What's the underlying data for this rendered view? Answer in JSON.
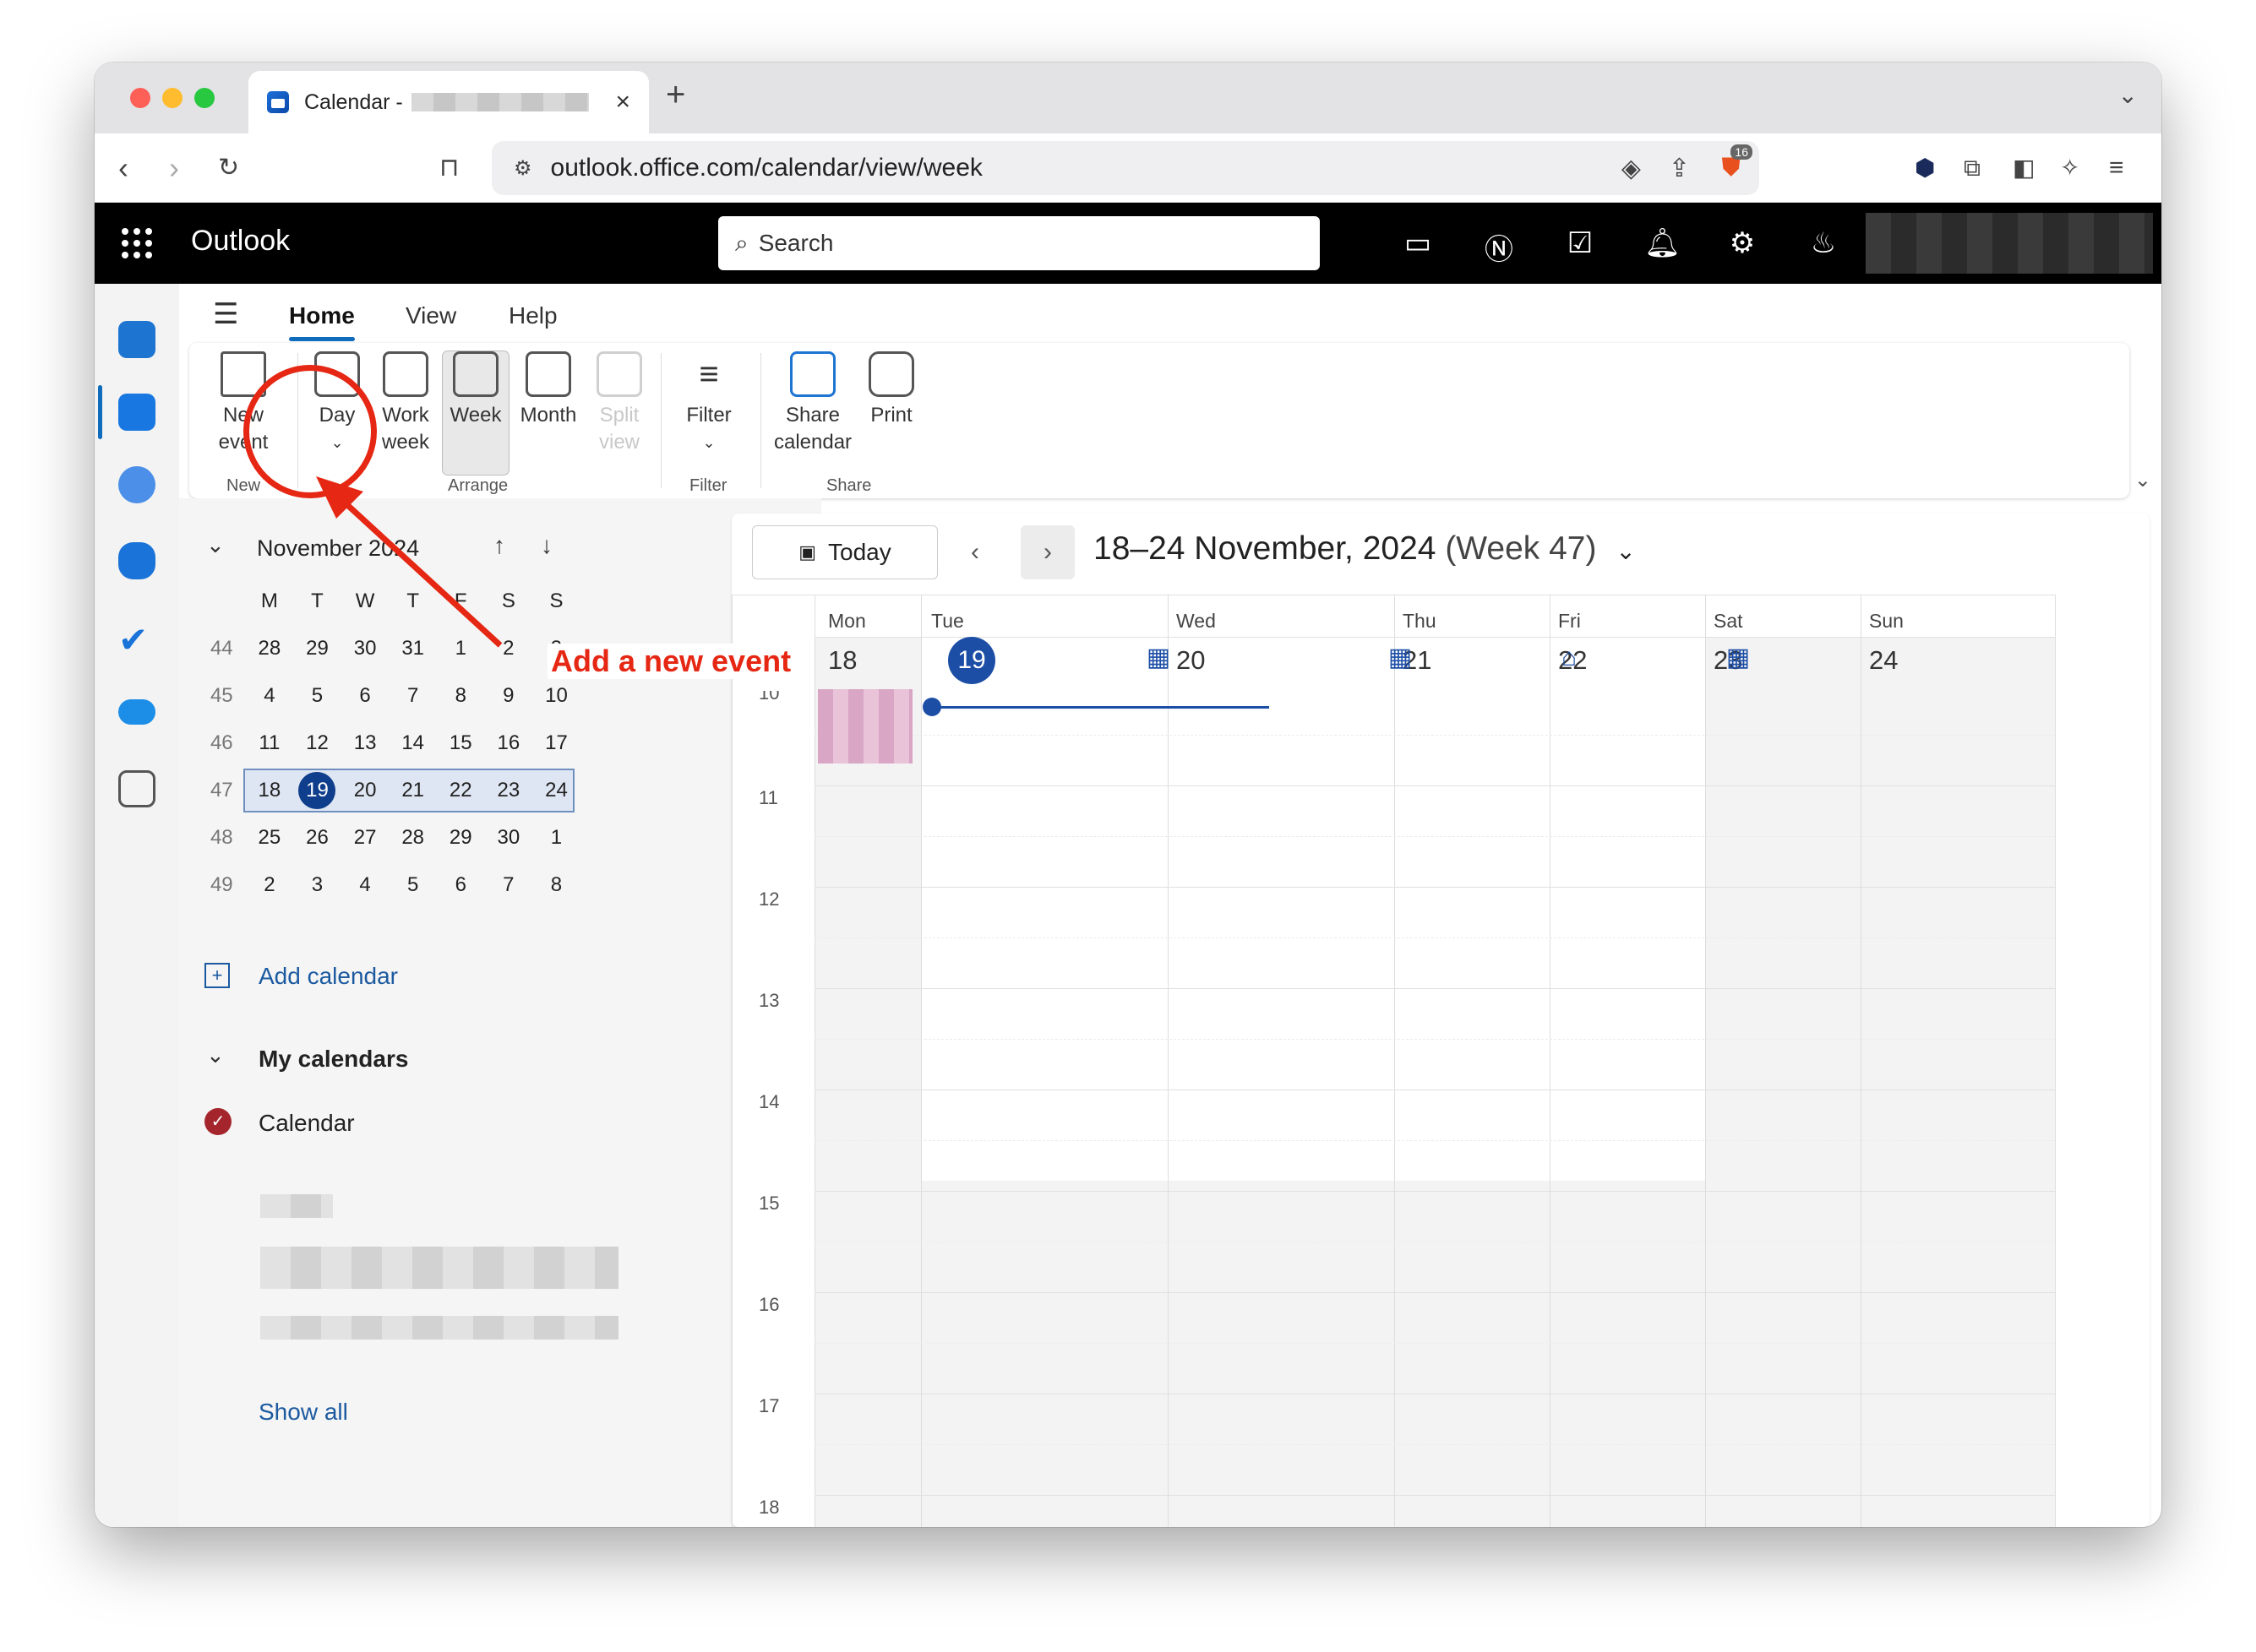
{
  "browser": {
    "tab_title": "Calendar - ",
    "url": "outlook.office.com/calendar/view/week",
    "shield_badge": "16"
  },
  "outlook": {
    "brand": "Outlook",
    "search_placeholder": "Search"
  },
  "ribbon": {
    "tabs": [
      "Home",
      "View",
      "Help"
    ],
    "buttons": {
      "new_event": "New\nevent",
      "day": "Day",
      "work_week": "Work\nweek",
      "week": "Week",
      "month": "Month",
      "split_view": "Split\nview",
      "filter": "Filter",
      "share_calendar": "Share\ncalendar",
      "print": "Print"
    },
    "groups": {
      "new": "New",
      "arrange": "Arrange",
      "filter": "Filter",
      "share": "Share"
    }
  },
  "mini_calendar": {
    "title": "November 2024",
    "weekdays": [
      "M",
      "T",
      "W",
      "T",
      "F",
      "S",
      "S"
    ],
    "weeks": [
      {
        "wk": "44",
        "days": [
          "28",
          "29",
          "30",
          "31",
          "1",
          "2",
          "3"
        ]
      },
      {
        "wk": "45",
        "days": [
          "4",
          "5",
          "6",
          "7",
          "8",
          "9",
          "10"
        ]
      },
      {
        "wk": "46",
        "days": [
          "11",
          "12",
          "13",
          "14",
          "15",
          "16",
          "17"
        ]
      },
      {
        "wk": "47",
        "days": [
          "18",
          "19",
          "20",
          "21",
          "22",
          "23",
          "24"
        ]
      },
      {
        "wk": "48",
        "days": [
          "25",
          "26",
          "27",
          "28",
          "29",
          "30",
          "1"
        ]
      },
      {
        "wk": "49",
        "days": [
          "2",
          "3",
          "4",
          "5",
          "6",
          "7",
          "8"
        ]
      }
    ],
    "today": "19"
  },
  "sidebar": {
    "add_calendar": "Add calendar",
    "my_calendars": "My calendars",
    "calendar_item": "Calendar",
    "show_all": "Show all"
  },
  "calendar": {
    "today_button": "Today",
    "range": "18–24 November, 2024",
    "week_label": "(Week 47)",
    "days": [
      {
        "name": "Mon",
        "num": "18"
      },
      {
        "name": "Tue",
        "num": "19"
      },
      {
        "name": "Wed",
        "num": "20"
      },
      {
        "name": "Thu",
        "num": "21"
      },
      {
        "name": "Fri",
        "num": "22"
      },
      {
        "name": "Sat",
        "num": "23"
      },
      {
        "name": "Sun",
        "num": "24"
      }
    ],
    "hours": [
      "10",
      "11",
      "12",
      "13",
      "14",
      "15",
      "16",
      "17",
      "18"
    ]
  },
  "annotation": {
    "text": "Add a new event",
    "color": "#e52713"
  }
}
